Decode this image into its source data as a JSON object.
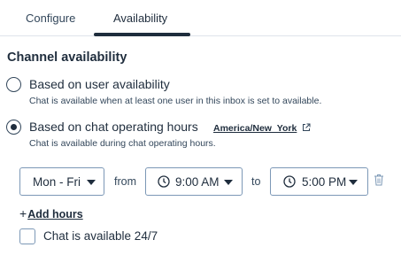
{
  "tabs": [
    {
      "label": "Configure",
      "active": false
    },
    {
      "label": "Availability",
      "active": true
    }
  ],
  "section": {
    "title": "Channel availability"
  },
  "options": [
    {
      "label": "Based on user availability",
      "help": "Chat is available when at least one user in this inbox is set to available.",
      "selected": false
    },
    {
      "label": "Based on chat operating hours",
      "help": "Chat is available during chat operating hours.",
      "selected": true
    }
  ],
  "timezone": {
    "label": "America/New_York",
    "icon": "external-link-icon"
  },
  "hours": {
    "days": "Mon - Fri",
    "from_word": "from",
    "from_time": "9:00 AM",
    "to_word": "to",
    "to_time": "5:00 PM",
    "delete_icon": "trash-icon"
  },
  "add_hours": {
    "plus": "+",
    "label": "Add hours"
  },
  "always_available": {
    "label": "Chat is available 24/7",
    "checked": false
  },
  "colors": {
    "text": "#1f2d3d",
    "border": "#7c98b6",
    "divider": "#dfe3eb"
  }
}
